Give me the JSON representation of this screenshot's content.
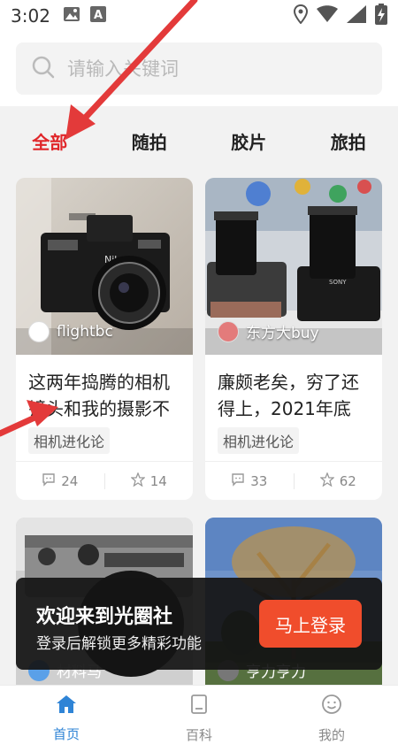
{
  "status_bar": {
    "time": "3:02"
  },
  "search": {
    "placeholder": "请输入关键词"
  },
  "tabs": [
    {
      "label": "全部",
      "active": true
    },
    {
      "label": "随拍",
      "active": false
    },
    {
      "label": "胶片",
      "active": false
    },
    {
      "label": "旅拍",
      "active": false
    }
  ],
  "cards": [
    {
      "author": "flightbc",
      "title": "这两年捣腾的相机镜头和我的摄影不",
      "tag": "相机进化论",
      "comments": "24",
      "favorites": "14"
    },
    {
      "author": "东方大buy",
      "title": "廉颇老矣，穷了还得上，2021年底",
      "tag": "相机进化论",
      "comments": "33",
      "favorites": "62"
    }
  ],
  "cards_row2": [
    {
      "author": "材料马"
    },
    {
      "author": "亨力亨力"
    }
  ],
  "login_banner": {
    "title": "欢迎来到光圈社",
    "subtitle": "登录后解锁更多精彩功能",
    "button": "马上登录"
  },
  "bottom_nav": [
    {
      "label": "首页",
      "icon": "home-icon",
      "active": true
    },
    {
      "label": "百科",
      "icon": "book-icon",
      "active": false
    },
    {
      "label": "我的",
      "icon": "profile-icon",
      "active": false
    }
  ],
  "colors": {
    "accent_red": "#e0262a",
    "login_button": "#f04d2c",
    "nav_active": "#2f84d6",
    "annotation_arrow": "#e33a3a"
  }
}
